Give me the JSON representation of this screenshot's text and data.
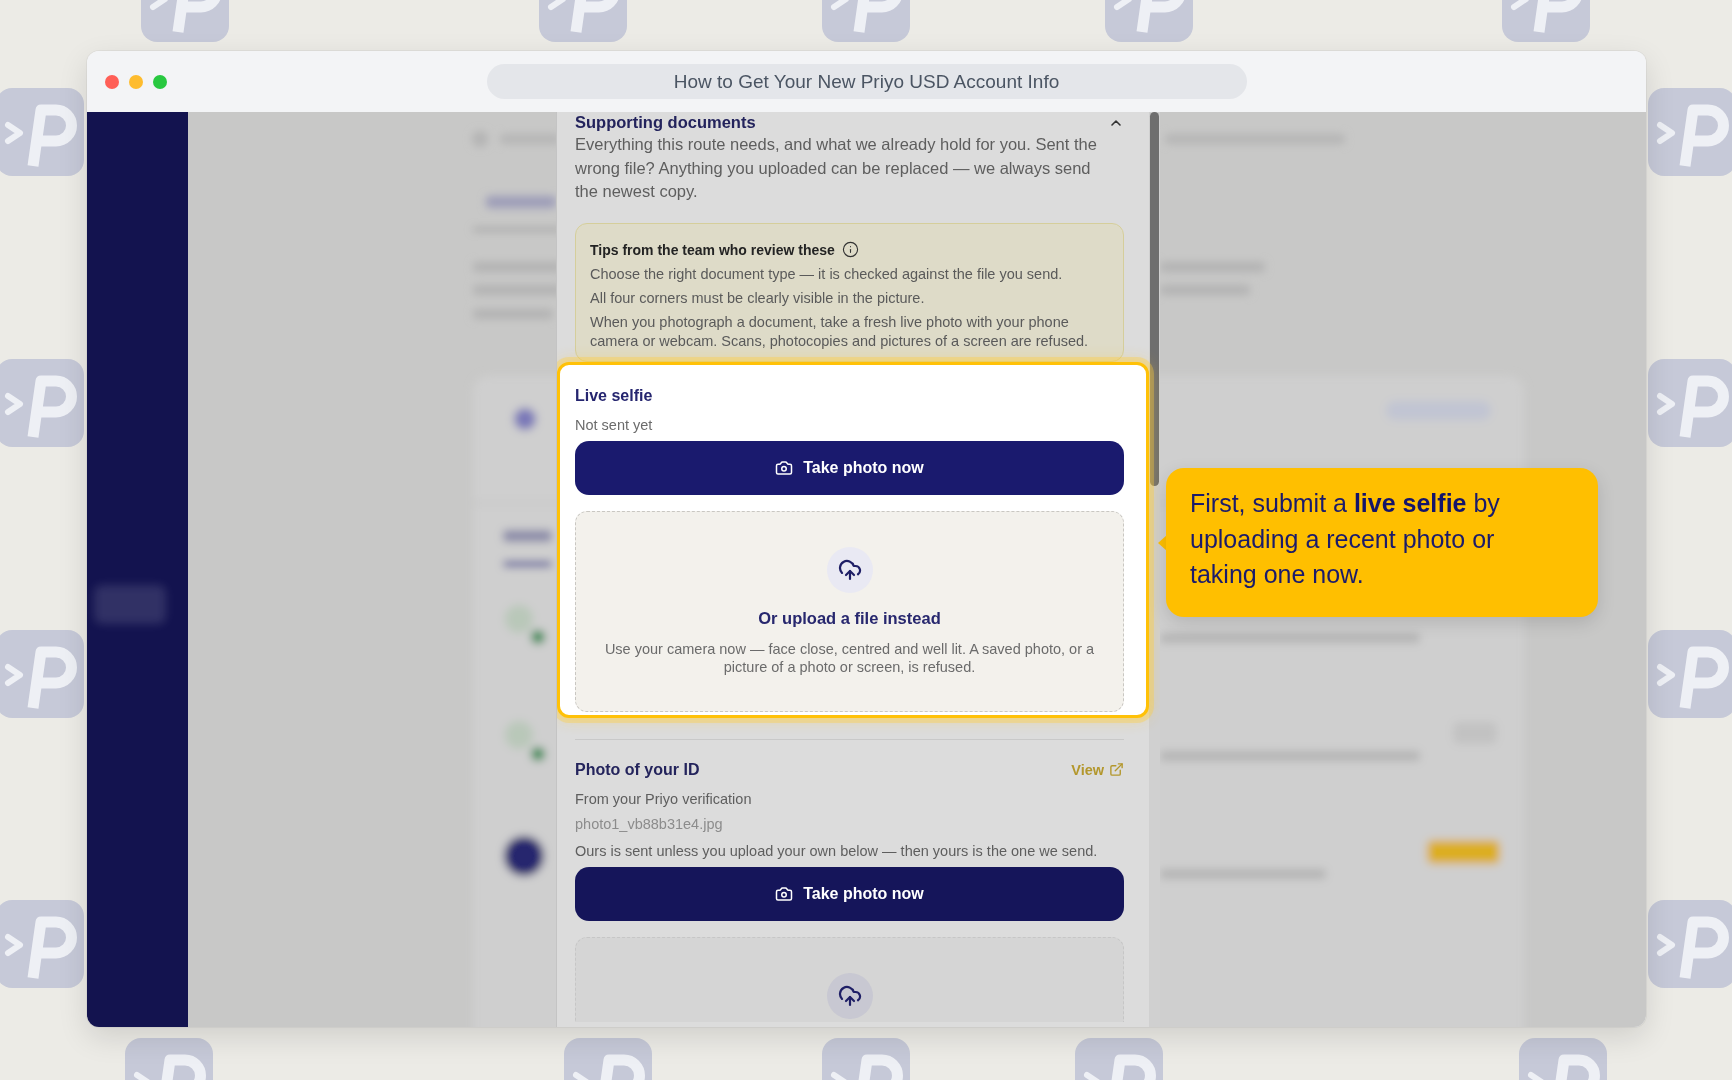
{
  "window": {
    "title": "How to Get Your New Priyo USD Account Info"
  },
  "panel": {
    "title": "Supporting documents",
    "expanded": true,
    "description": "Everything this route needs, and what we already hold for you. Sent the wrong file? Anything you uploaded can be replaced — we always send the newest copy.",
    "tips": {
      "title": "Tips from the team who review these",
      "items": [
        "Choose the right document type — it is checked against the file you send.",
        "All four corners must be clearly visible in the picture.",
        "When you photograph a document, take a fresh live photo with your phone camera or webcam. Scans, photocopies and pictures of a screen are refused."
      ]
    },
    "documents": [
      {
        "title": "Live selfie",
        "highlighted": true,
        "status": "Not sent yet",
        "button": "Take photo now",
        "upload": {
          "title": "Or upload a file instead",
          "hint": "Use your camera now — face close, centred and well lit. A saved photo, or a picture of a photo or screen, is refused."
        }
      },
      {
        "title": "Photo of your ID",
        "highlighted": false,
        "link": "View",
        "status": "From your Priyo verification",
        "file": "photo1_vb88b31e4.jpg",
        "note": "Ours is sent unless you upload your own below — then yours is the one we send.",
        "button": "Take photo now"
      }
    ]
  },
  "callout": {
    "text": "First, submit a **live selfie** by uploading a recent photo or taking one now."
  }
}
